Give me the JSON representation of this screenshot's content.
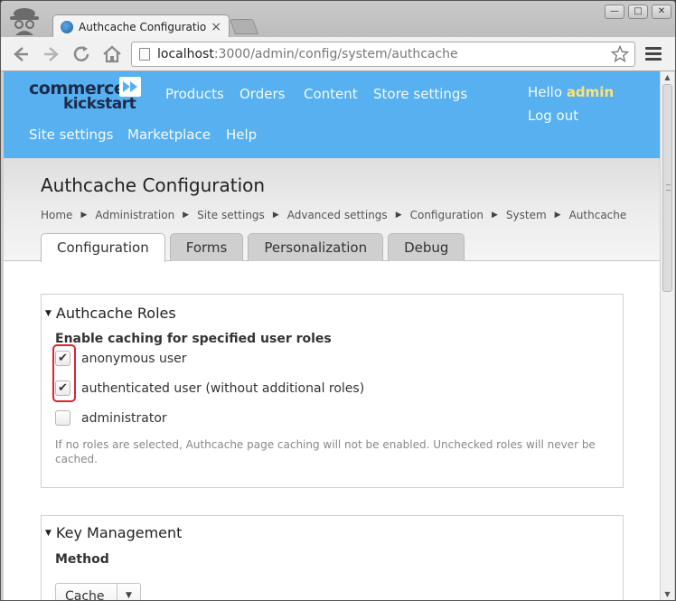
{
  "browser": {
    "tab_title": "Authcache Configuration |",
    "tab_close": "×",
    "window_buttons": [
      "—",
      "□",
      "✕"
    ],
    "url_host": "localhost",
    "url_path": ":3000/admin/config/system/authcache"
  },
  "site": {
    "logo": [
      "commerce",
      "kickstart"
    ],
    "nav": [
      "Products",
      "Orders",
      "Content",
      "Store settings",
      "Site settings",
      "Marketplace",
      "Help"
    ],
    "hello": "Hello",
    "username": "admin",
    "logout": "Log out"
  },
  "page": {
    "title": "Authcache Configuration",
    "breadcrumb": [
      "Home",
      "Administration",
      "Site settings",
      "Advanced settings",
      "Configuration",
      "System",
      "Authcache"
    ],
    "breadcrumb_separator": "▶",
    "tabs": [
      "Configuration",
      "Forms",
      "Personalization",
      "Debug"
    ],
    "active_tab": "Configuration"
  },
  "roles": {
    "legend": "Authcache Roles",
    "label": "Enable caching for specified user roles",
    "options": [
      {
        "label": "anonymous user",
        "checked": true
      },
      {
        "label": "authenticated user (without additional roles)",
        "checked": true
      },
      {
        "label": "administrator",
        "checked": false
      }
    ],
    "description": "If no roles are selected, Authcache page caching will not be enabled. Unchecked roles will never be cached."
  },
  "keys": {
    "legend": "Key Management",
    "method_label": "Method",
    "method_value": "Cache"
  },
  "colors": {
    "header_blue": "#57b0f0",
    "username_yellow": "#ffe27a",
    "highlight_red": "#d9262e"
  }
}
